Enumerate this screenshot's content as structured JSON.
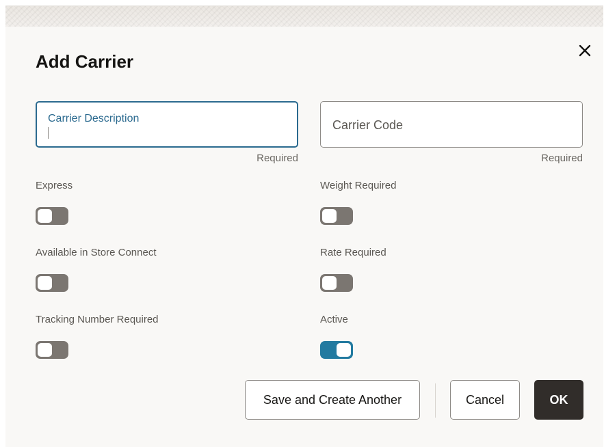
{
  "dialog": {
    "title": "Add Carrier",
    "close_icon": "close-icon"
  },
  "fields": {
    "carrier_description": {
      "label": "Carrier Description",
      "value": "",
      "helper": "Required",
      "focused": true
    },
    "carrier_code": {
      "placeholder": "Carrier Code",
      "value": "",
      "helper": "Required"
    }
  },
  "toggles": [
    {
      "label": "Express",
      "checked": false
    },
    {
      "label": "Weight Required",
      "checked": false
    },
    {
      "label": "Available in Store Connect",
      "checked": false
    },
    {
      "label": "Rate Required",
      "checked": false
    },
    {
      "label": "Tracking Number Required",
      "checked": false
    },
    {
      "label": "Active",
      "checked": true
    }
  ],
  "buttons": {
    "save_and_create_another": "Save and Create Another",
    "cancel": "Cancel",
    "ok": "OK"
  },
  "colors": {
    "accent": "#227aa0",
    "focus_border": "#2b6a8f",
    "toggle_off": "#7b7671",
    "primary_button": "#312d2a",
    "dialog_background": "#f9f8f6"
  }
}
